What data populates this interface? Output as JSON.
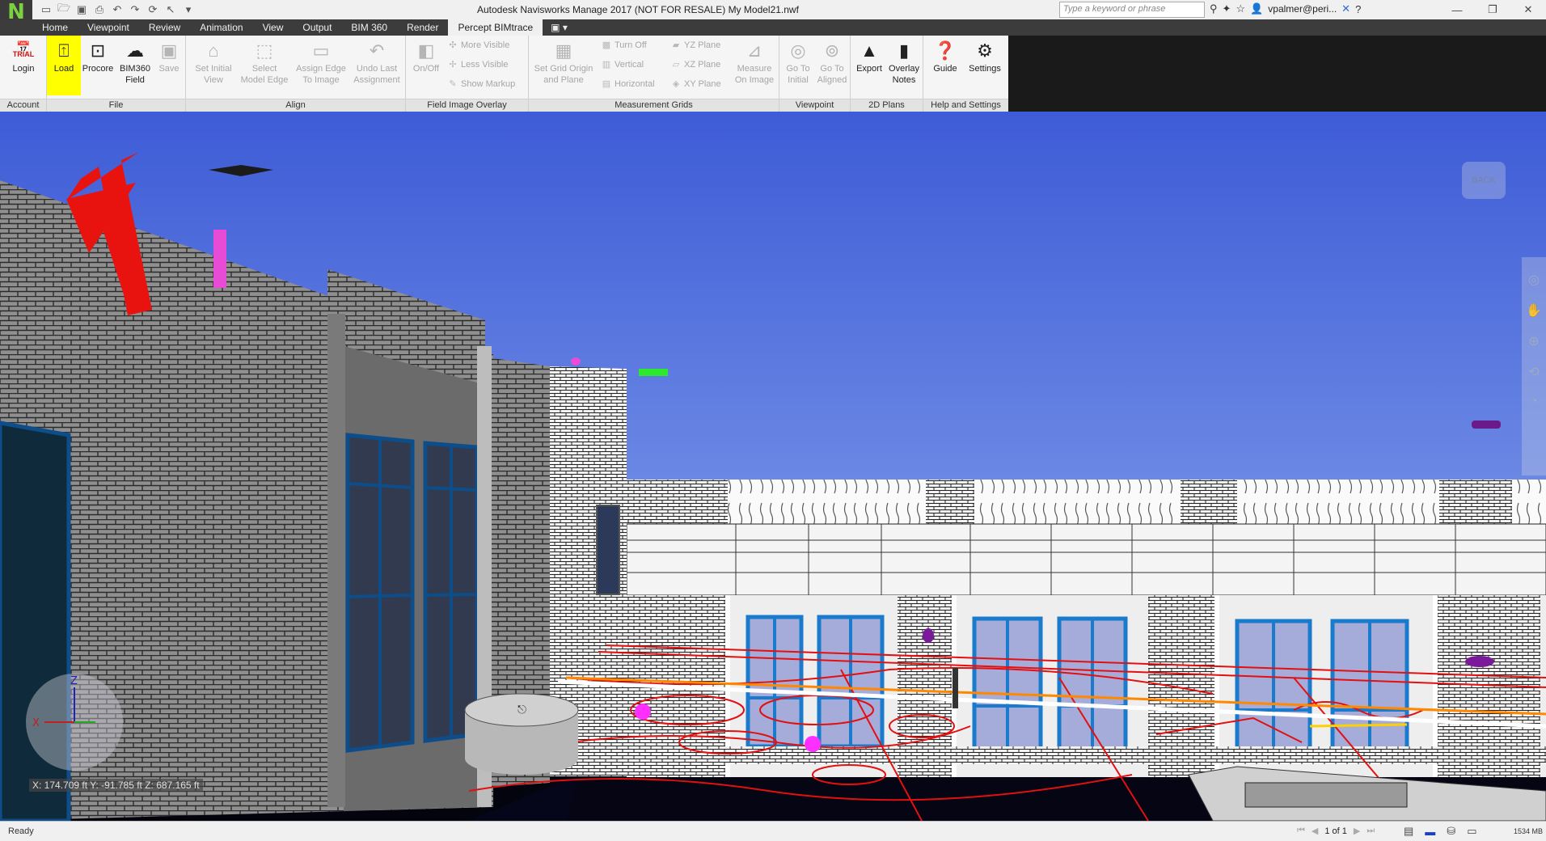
{
  "titlebar": {
    "logo": "N",
    "title": "Autodesk Navisworks Manage 2017 (NOT FOR RESALE)    My Model21.nwf",
    "search_placeholder": "Type a keyword or phrase",
    "user": "vpalmer@peri...",
    "qat_icons": [
      "new-icon",
      "open-icon",
      "save-icon",
      "print-icon",
      "undo-icon",
      "redo-icon",
      "refresh-icon",
      "select-icon",
      "customize-icon"
    ]
  },
  "tabs": [
    {
      "label": "Home"
    },
    {
      "label": "Viewpoint"
    },
    {
      "label": "Review"
    },
    {
      "label": "Animation"
    },
    {
      "label": "View"
    },
    {
      "label": "Output"
    },
    {
      "label": "BIM 360"
    },
    {
      "label": "Render"
    },
    {
      "label": "Percept BIMtrace",
      "active": true
    }
  ],
  "tab_extra": "▣ ▾",
  "ribbon": {
    "account": {
      "label": "Account",
      "login": "Login",
      "trial": "TRIAL"
    },
    "file": {
      "label": "File",
      "load": "Load",
      "procore": "Procore",
      "bim360_1": "BIM360",
      "bim360_2": "Field",
      "save": "Save"
    },
    "align": {
      "label": "Align",
      "set_initial_1": "Set Initial",
      "set_initial_2": "View",
      "select_edge_1": "Select",
      "select_edge_2": "Model Edge",
      "assign_edge_1": "Assign Edge",
      "assign_edge_2": "To Image",
      "undo_last_1": "Undo Last",
      "undo_last_2": "Assignment"
    },
    "overlay": {
      "label": "Field Image Overlay",
      "onoff": "On/Off",
      "more_visible": "More Visible",
      "less_visible": "Less Visible",
      "show_markup": "Show Markup"
    },
    "grids": {
      "label": "Measurement Grids",
      "set_grid_1": "Set Grid Origin",
      "set_grid_2": "and Plane",
      "turn_off": "Turn Off",
      "vertical": "Vertical",
      "horizontal": "Horizontal",
      "yz_plane": "YZ Plane",
      "xz_plane": "XZ Plane",
      "xy_plane": "XY Plane",
      "measure_1": "Measure",
      "measure_2": "On Image"
    },
    "viewpoint": {
      "label": "Viewpoint",
      "go_initial_1": "Go To",
      "go_initial_2": "Initial",
      "go_aligned_1": "Go To",
      "go_aligned_2": "Aligned"
    },
    "plans": {
      "label": "2D Plans",
      "export": "Export",
      "overlay_1": "Overlay",
      "overlay_2": "Notes"
    },
    "help": {
      "label": "Help and Settings",
      "guide": "Guide",
      "settings": "Settings"
    }
  },
  "viewport": {
    "coords": "X: 174.709 ft  Y: -91.785 ft  Z: 687.165 ft",
    "back_label": "BACK",
    "axis_labels": {
      "x": "X",
      "z": "Z"
    },
    "colors": {
      "sky": "#5a78dc",
      "floor": "#04040f",
      "markup_red": "#e21010",
      "arrow": "#e8120e"
    }
  },
  "statusbar": {
    "status": "Ready",
    "page": "1 of 1",
    "memory": "1534 MB"
  }
}
